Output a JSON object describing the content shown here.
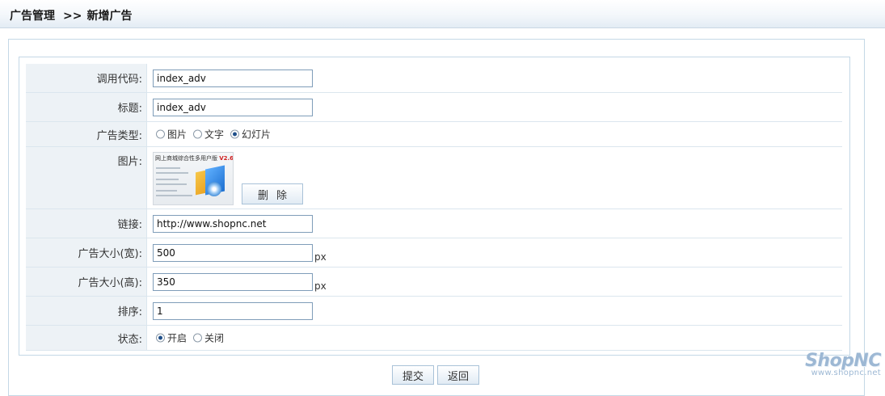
{
  "breadcrumb": {
    "parent": "广告管理",
    "separator": ">>",
    "current": "新增广告"
  },
  "form": {
    "call_code": {
      "label": "调用代码:",
      "value": "index_adv"
    },
    "title": {
      "label": "标题:",
      "value": "index_adv"
    },
    "ad_type": {
      "label": "广告类型:",
      "options": [
        {
          "label": "图片",
          "checked": false
        },
        {
          "label": "文字",
          "checked": false
        },
        {
          "label": "幻灯片",
          "checked": true
        }
      ]
    },
    "image": {
      "label": "图片:",
      "thumb_title": "网上商城综合性多用户版",
      "thumb_version": "V2.6",
      "delete_label": "删除"
    },
    "link": {
      "label": "链接:",
      "value": "http://www.shopnc.net"
    },
    "width": {
      "label": "广告大小(宽):",
      "value": "500",
      "unit": "px"
    },
    "height": {
      "label": "广告大小(高):",
      "value": "350",
      "unit": "px"
    },
    "sort": {
      "label": "排序:",
      "value": "1"
    },
    "status": {
      "label": "状态:",
      "options": [
        {
          "label": "开启",
          "checked": true
        },
        {
          "label": "关闭",
          "checked": false
        }
      ]
    }
  },
  "actions": {
    "submit_label": "提交",
    "back_label": "返回"
  },
  "logo": {
    "brand": "ShopNC",
    "site": "www.shopnc.net"
  }
}
